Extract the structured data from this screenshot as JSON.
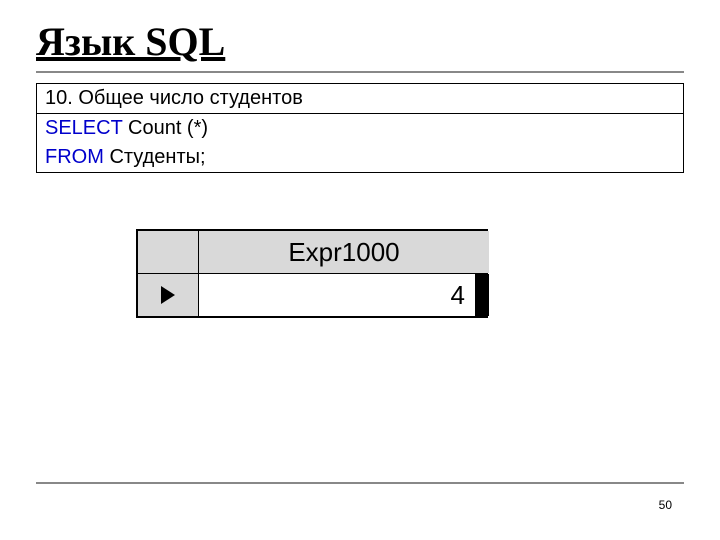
{
  "title": "Язык SQL",
  "codebox": {
    "header": "10. Общее число студентов",
    "line1_kw": "SELECT",
    "line1_rest": " Count (*)",
    "line2_kw": "FROM",
    "line2_rest": " Студенты;"
  },
  "result": {
    "column_header": "Expr1000",
    "value": "4"
  },
  "page_number": "50"
}
